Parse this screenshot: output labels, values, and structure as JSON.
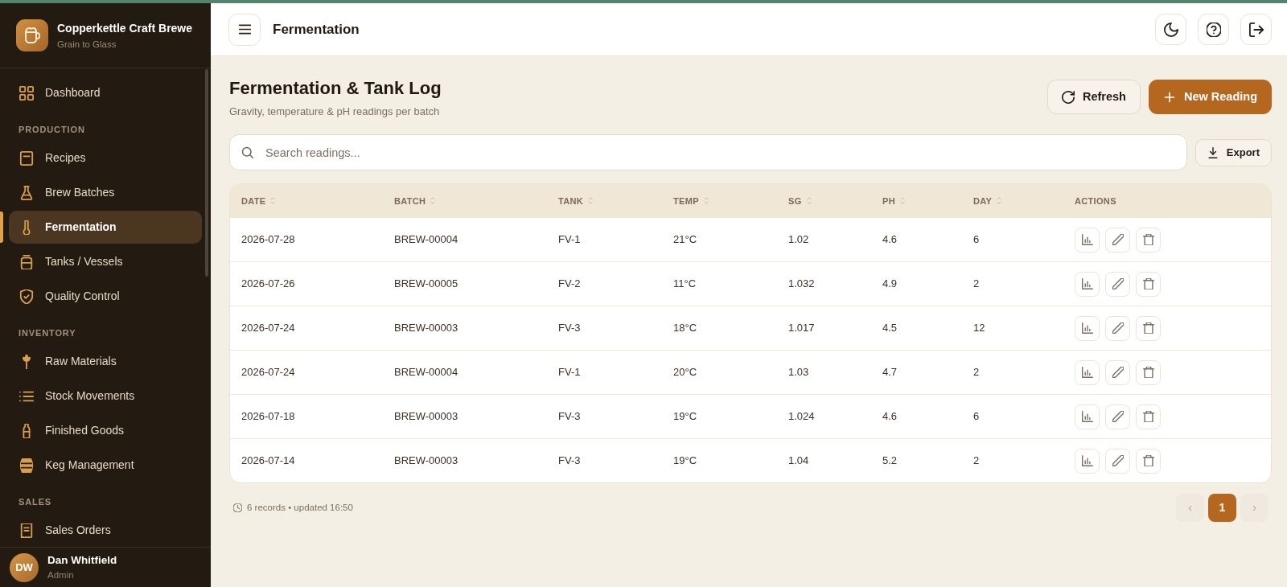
{
  "sidebar": {
    "brand": {
      "name": "Copperkettle Craft Brewe",
      "tagline": "Grain to Glass"
    },
    "sections": [
      {
        "items": [
          {
            "label": "Dashboard",
            "selected": false
          }
        ]
      },
      {
        "heading": "PRODUCTION",
        "items": [
          {
            "label": "Recipes",
            "selected": false
          },
          {
            "label": "Brew Batches",
            "selected": false
          },
          {
            "label": "Fermentation",
            "selected": true
          },
          {
            "label": "Tanks / Vessels",
            "selected": false
          },
          {
            "label": "Quality Control",
            "selected": false
          }
        ]
      },
      {
        "heading": "INVENTORY",
        "items": [
          {
            "label": "Raw Materials",
            "selected": false
          },
          {
            "label": "Stock Movements",
            "selected": false
          },
          {
            "label": "Finished Goods",
            "selected": false
          },
          {
            "label": "Keg Management",
            "selected": false
          }
        ]
      },
      {
        "heading": "SALES",
        "items": [
          {
            "label": "Sales Orders",
            "selected": false
          }
        ]
      }
    ],
    "user": {
      "initials": "DW",
      "name": "Dan Whitfield",
      "role": "Admin"
    }
  },
  "header": {
    "title": "Fermentation"
  },
  "page": {
    "title": "Fermentation & Tank Log",
    "subtitle": "Gravity, temperature & pH readings per batch",
    "actions": [
      {
        "label": "Refresh",
        "kind": "secondary"
      },
      {
        "label": "New Reading",
        "kind": "primary"
      }
    ]
  },
  "search": {
    "placeholder": "Search readings..."
  },
  "export": {
    "label": "Export"
  },
  "table": {
    "columns": [
      {
        "label": "DATE",
        "sortable": true
      },
      {
        "label": "BATCH",
        "sortable": true
      },
      {
        "label": "TANK",
        "sortable": true
      },
      {
        "label": "TEMP",
        "sortable": true
      },
      {
        "label": "SG",
        "sortable": true
      },
      {
        "label": "PH",
        "sortable": true
      },
      {
        "label": "DAY",
        "sortable": true
      },
      {
        "label": "ACTIONS",
        "sortable": false
      }
    ],
    "rows": [
      [
        "2026-07-28",
        "BREW-00004",
        "FV-1",
        "21°C",
        "1.02",
        "4.6",
        "6"
      ],
      [
        "2026-07-26",
        "BREW-00005",
        "FV-2",
        "11°C",
        "1.032",
        "4.9",
        "2"
      ],
      [
        "2026-07-24",
        "BREW-00003",
        "FV-3",
        "18°C",
        "1.017",
        "4.5",
        "12"
      ],
      [
        "2026-07-24",
        "BREW-00004",
        "FV-1",
        "20°C",
        "1.03",
        "4.7",
        "2"
      ],
      [
        "2026-07-18",
        "BREW-00003",
        "FV-3",
        "19°C",
        "1.024",
        "4.6",
        "6"
      ],
      [
        "2026-07-14",
        "BREW-00003",
        "FV-3",
        "19°C",
        "1.04",
        "5.2",
        "2"
      ]
    ]
  },
  "footer": {
    "summary": "6 records • updated 16:50"
  },
  "pagination": {
    "prev": {
      "label": "‹",
      "disabled": true
    },
    "pages": [
      {
        "label": "1",
        "selected": true
      }
    ],
    "next": {
      "label": "›",
      "disabled": true
    }
  }
}
